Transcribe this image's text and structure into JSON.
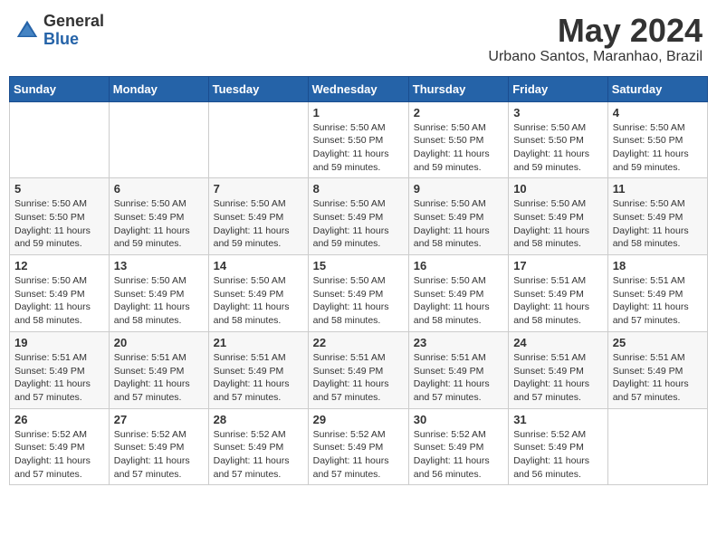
{
  "header": {
    "logo_general": "General",
    "logo_blue": "Blue",
    "title": "May 2024",
    "location": "Urbano Santos, Maranhao, Brazil"
  },
  "weekdays": [
    "Sunday",
    "Monday",
    "Tuesday",
    "Wednesday",
    "Thursday",
    "Friday",
    "Saturday"
  ],
  "weeks": [
    [
      {
        "day": "",
        "info": ""
      },
      {
        "day": "",
        "info": ""
      },
      {
        "day": "",
        "info": ""
      },
      {
        "day": "1",
        "info": "Sunrise: 5:50 AM\nSunset: 5:50 PM\nDaylight: 11 hours\nand 59 minutes."
      },
      {
        "day": "2",
        "info": "Sunrise: 5:50 AM\nSunset: 5:50 PM\nDaylight: 11 hours\nand 59 minutes."
      },
      {
        "day": "3",
        "info": "Sunrise: 5:50 AM\nSunset: 5:50 PM\nDaylight: 11 hours\nand 59 minutes."
      },
      {
        "day": "4",
        "info": "Sunrise: 5:50 AM\nSunset: 5:50 PM\nDaylight: 11 hours\nand 59 minutes."
      }
    ],
    [
      {
        "day": "5",
        "info": "Sunrise: 5:50 AM\nSunset: 5:50 PM\nDaylight: 11 hours\nand 59 minutes."
      },
      {
        "day": "6",
        "info": "Sunrise: 5:50 AM\nSunset: 5:49 PM\nDaylight: 11 hours\nand 59 minutes."
      },
      {
        "day": "7",
        "info": "Sunrise: 5:50 AM\nSunset: 5:49 PM\nDaylight: 11 hours\nand 59 minutes."
      },
      {
        "day": "8",
        "info": "Sunrise: 5:50 AM\nSunset: 5:49 PM\nDaylight: 11 hours\nand 59 minutes."
      },
      {
        "day": "9",
        "info": "Sunrise: 5:50 AM\nSunset: 5:49 PM\nDaylight: 11 hours\nand 58 minutes."
      },
      {
        "day": "10",
        "info": "Sunrise: 5:50 AM\nSunset: 5:49 PM\nDaylight: 11 hours\nand 58 minutes."
      },
      {
        "day": "11",
        "info": "Sunrise: 5:50 AM\nSunset: 5:49 PM\nDaylight: 11 hours\nand 58 minutes."
      }
    ],
    [
      {
        "day": "12",
        "info": "Sunrise: 5:50 AM\nSunset: 5:49 PM\nDaylight: 11 hours\nand 58 minutes."
      },
      {
        "day": "13",
        "info": "Sunrise: 5:50 AM\nSunset: 5:49 PM\nDaylight: 11 hours\nand 58 minutes."
      },
      {
        "day": "14",
        "info": "Sunrise: 5:50 AM\nSunset: 5:49 PM\nDaylight: 11 hours\nand 58 minutes."
      },
      {
        "day": "15",
        "info": "Sunrise: 5:50 AM\nSunset: 5:49 PM\nDaylight: 11 hours\nand 58 minutes."
      },
      {
        "day": "16",
        "info": "Sunrise: 5:50 AM\nSunset: 5:49 PM\nDaylight: 11 hours\nand 58 minutes."
      },
      {
        "day": "17",
        "info": "Sunrise: 5:51 AM\nSunset: 5:49 PM\nDaylight: 11 hours\nand 58 minutes."
      },
      {
        "day": "18",
        "info": "Sunrise: 5:51 AM\nSunset: 5:49 PM\nDaylight: 11 hours\nand 57 minutes."
      }
    ],
    [
      {
        "day": "19",
        "info": "Sunrise: 5:51 AM\nSunset: 5:49 PM\nDaylight: 11 hours\nand 57 minutes."
      },
      {
        "day": "20",
        "info": "Sunrise: 5:51 AM\nSunset: 5:49 PM\nDaylight: 11 hours\nand 57 minutes."
      },
      {
        "day": "21",
        "info": "Sunrise: 5:51 AM\nSunset: 5:49 PM\nDaylight: 11 hours\nand 57 minutes."
      },
      {
        "day": "22",
        "info": "Sunrise: 5:51 AM\nSunset: 5:49 PM\nDaylight: 11 hours\nand 57 minutes."
      },
      {
        "day": "23",
        "info": "Sunrise: 5:51 AM\nSunset: 5:49 PM\nDaylight: 11 hours\nand 57 minutes."
      },
      {
        "day": "24",
        "info": "Sunrise: 5:51 AM\nSunset: 5:49 PM\nDaylight: 11 hours\nand 57 minutes."
      },
      {
        "day": "25",
        "info": "Sunrise: 5:51 AM\nSunset: 5:49 PM\nDaylight: 11 hours\nand 57 minutes."
      }
    ],
    [
      {
        "day": "26",
        "info": "Sunrise: 5:52 AM\nSunset: 5:49 PM\nDaylight: 11 hours\nand 57 minutes."
      },
      {
        "day": "27",
        "info": "Sunrise: 5:52 AM\nSunset: 5:49 PM\nDaylight: 11 hours\nand 57 minutes."
      },
      {
        "day": "28",
        "info": "Sunrise: 5:52 AM\nSunset: 5:49 PM\nDaylight: 11 hours\nand 57 minutes."
      },
      {
        "day": "29",
        "info": "Sunrise: 5:52 AM\nSunset: 5:49 PM\nDaylight: 11 hours\nand 57 minutes."
      },
      {
        "day": "30",
        "info": "Sunrise: 5:52 AM\nSunset: 5:49 PM\nDaylight: 11 hours\nand 56 minutes."
      },
      {
        "day": "31",
        "info": "Sunrise: 5:52 AM\nSunset: 5:49 PM\nDaylight: 11 hours\nand 56 minutes."
      },
      {
        "day": "",
        "info": ""
      }
    ]
  ]
}
